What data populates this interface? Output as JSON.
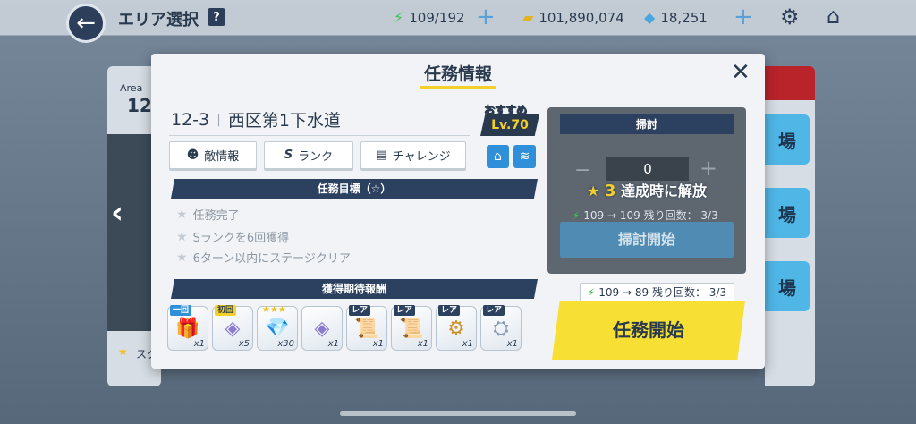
{
  "header": {
    "title": "エリア選択",
    "help": "?",
    "stamina": "109/192",
    "credits": "101,890,074",
    "gems": "18,251"
  },
  "background": {
    "area_label": "Area",
    "area_num": "12",
    "left_star_label": "スク",
    "right_buttons": [
      "場",
      "場",
      "場"
    ]
  },
  "modal": {
    "title": "任務情報",
    "stage_num": "12-3",
    "stage_name": "西区第1下水道",
    "recommended_label": "おすすめ",
    "recommended_level": "Lv.70",
    "tabs": [
      {
        "icon": "☻",
        "label": "敵情報"
      },
      {
        "icon": "S",
        "label": "ランク"
      },
      {
        "icon": "▤",
        "label": "チャレンジ"
      }
    ],
    "goals_header": "任務目標（☆）",
    "goals": [
      "任務完了",
      "Sランクを6回獲得",
      "6ターン以内にステージクリア"
    ],
    "rewards_header": "獲得期待報酬",
    "rewards": [
      {
        "tag": "一回",
        "tag_type": "once",
        "item": "🎁",
        "qty": "x1"
      },
      {
        "tag": "初回",
        "tag_type": "first",
        "item": "◈",
        "qty": "x5"
      },
      {
        "tag": "★★★",
        "tag_type": "stars",
        "item": "💎",
        "qty": "x30"
      },
      {
        "tag": "",
        "tag_type": "",
        "item": "◈",
        "qty": "x1"
      },
      {
        "tag": "レア",
        "tag_type": "rare",
        "item": "📜",
        "qty": "x1"
      },
      {
        "tag": "レア",
        "tag_type": "rare",
        "item": "📜",
        "qty": "x1"
      },
      {
        "tag": "レア",
        "tag_type": "rare",
        "item": "⚙",
        "qty": "x1"
      },
      {
        "tag": "レア",
        "tag_type": "rare",
        "item": "⛭",
        "qty": "x1"
      }
    ],
    "sweep": {
      "header": "掃討",
      "count": "0",
      "lock_stars": "3",
      "lock_text": "達成時に解放",
      "cost": "109 → 109",
      "remaining": "残り回数： 3/3",
      "button": "掃討開始"
    },
    "start": {
      "cost": "109 → 89",
      "remaining": "残り回数： 3/3",
      "button": "任務開始"
    }
  }
}
